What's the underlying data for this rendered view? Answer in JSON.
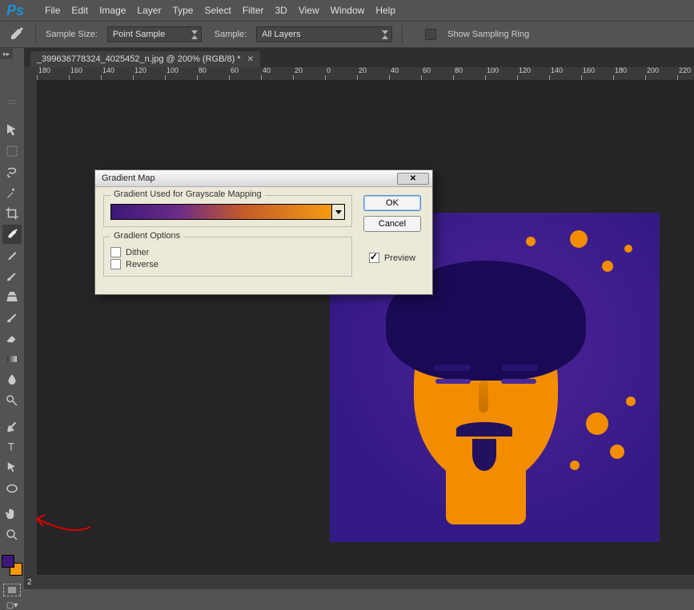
{
  "app": {
    "name": "Ps"
  },
  "menu": [
    "File",
    "Edit",
    "Image",
    "Layer",
    "Type",
    "Select",
    "Filter",
    "3D",
    "View",
    "Window",
    "Help"
  ],
  "options": {
    "sample_size_label": "Sample Size:",
    "sample_size_value": "Point Sample",
    "sample_label": "Sample:",
    "sample_value": "All Layers",
    "sampling_ring_label": "Show Sampling Ring"
  },
  "document": {
    "tab_title": "_399636778324_4025452_n.jpg @ 200% (RGB/8) *",
    "zoom": "2"
  },
  "ruler_ticks": [
    180,
    160,
    140,
    120,
    100,
    80,
    60,
    40,
    20,
    0,
    20,
    40,
    60,
    80,
    100,
    120,
    140,
    160,
    180,
    200,
    220
  ],
  "dialog": {
    "title": "Gradient Map",
    "group_gradient": "Gradient Used for Grayscale Mapping",
    "group_options": "Gradient Options",
    "dither": "Dither",
    "reverse": "Reverse",
    "ok": "OK",
    "cancel": "Cancel",
    "preview": "Preview",
    "preview_checked": true
  },
  "swatches": {
    "fg": "#3b1878",
    "bg": "#f4980c"
  }
}
